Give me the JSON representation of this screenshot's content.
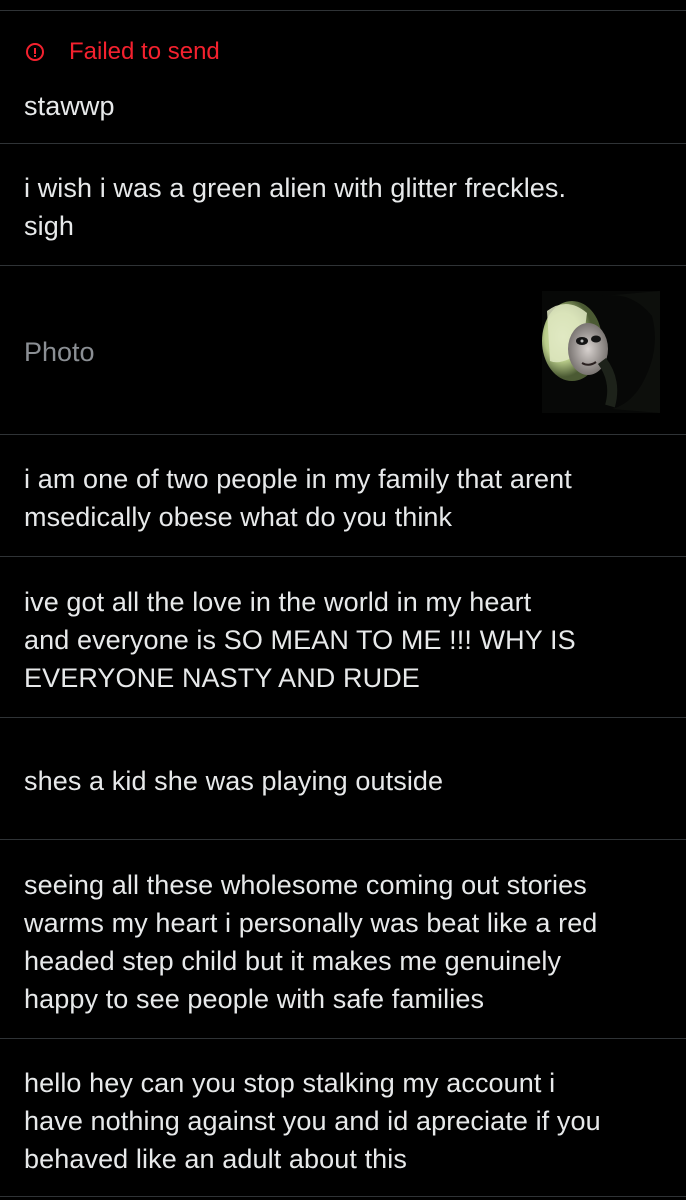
{
  "failed_status": {
    "icon": "alert-circle-icon",
    "text": "Failed to send",
    "color": "#f4212e"
  },
  "messages": [
    {
      "text": "stawwp"
    },
    {
      "text": "i wish i was a green alien with glitter freckles.\nsigh"
    },
    {
      "text": "Photo",
      "type": "photo"
    },
    {
      "text": "i am one of two people in my family that arent\nmsedically obese what do you think"
    },
    {
      "text": "ive got all the love in the world in my heart\nand everyone is SO MEAN TO ME !!! WHY IS\nEVERYONE NASTY AND RUDE"
    },
    {
      "text": "shes a kid she was playing outside"
    },
    {
      "text": "seeing all these wholesome coming out stories\nwarms my heart i personally was beat like a red\nheaded step child but it makes me genuinely\nhappy to see people with safe families"
    },
    {
      "text": "hello hey can you stop stalking my account i\nhave nothing against you and id apreciate if you\nbehaved like an adult about this"
    }
  ],
  "colors": {
    "background": "#000000",
    "text": "#e7e9ea",
    "muted": "#8b8f94",
    "divider": "#2f3336"
  }
}
